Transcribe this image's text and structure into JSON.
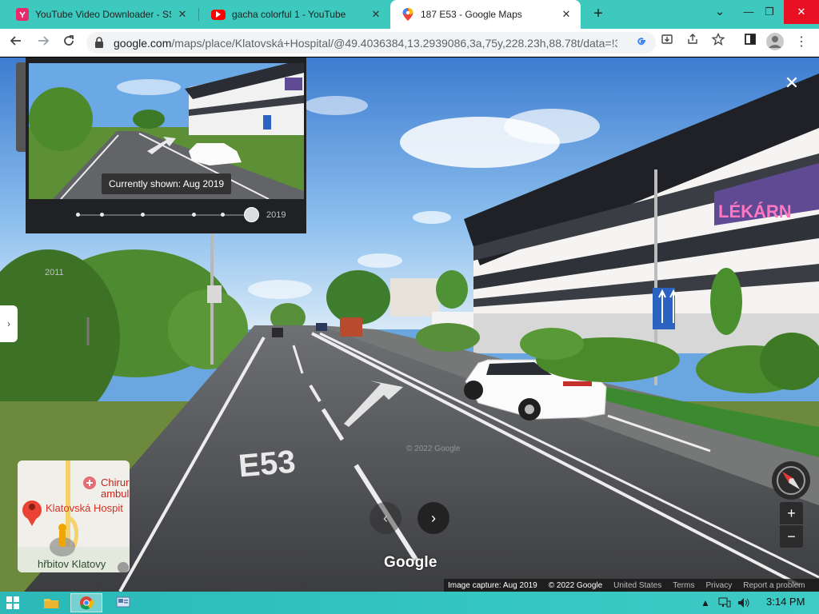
{
  "tabs": [
    {
      "title": "YouTube Video Downloader - SS",
      "favicon": "ssyoutube-icon",
      "active": false
    },
    {
      "title": "gacha colorful 1 - YouTube",
      "favicon": "youtube-icon",
      "active": false
    },
    {
      "title": "187 E53 - Google Maps",
      "favicon": "google-maps-icon",
      "active": true
    }
  ],
  "window_controls": {
    "new_tab": "+",
    "tab_search": "⌄",
    "minimize": "—",
    "restore": "❐",
    "close": "✕"
  },
  "toolbar": {
    "url_host": "google.com",
    "url_path": "/maps/place/Klatovská+Hospital/@49.4036384,13.2939086,3a,75y,228.23h,88.78t/data=!3...",
    "icons": [
      "back-icon",
      "forward-icon",
      "reload-icon",
      "lock-icon",
      "google-lens-icon",
      "install-icon",
      "share-icon",
      "bookmark-star-icon",
      "side-panel-icon",
      "profile-icon",
      "menu-icon"
    ]
  },
  "timeline": {
    "tooltip": "Currently shown: Aug 2019",
    "start_year": "2011",
    "end_year": "2019",
    "selected_fraction": 1.0
  },
  "streetview": {
    "road_marking": "E53",
    "building_sign": "LÉKÁRN",
    "watermark": "© 2022 Google",
    "logo": "Google"
  },
  "minimap": {
    "labels": [
      "Chirur",
      "ambul",
      "Klatovská Hospit",
      "hřbitov Klatovy"
    ]
  },
  "attribution": {
    "capture": "Image capture: Aug 2019",
    "copyright": "© 2022 Google",
    "country": "United States",
    "terms": "Terms",
    "privacy": "Privacy",
    "report": "Report a problem"
  },
  "controls": {
    "zoom_in": "+",
    "zoom_out": "−",
    "close": "✕",
    "next": "›",
    "prev": "‹",
    "side": "›"
  },
  "taskbar": {
    "time": "3:14 PM",
    "apps": [
      "file-explorer-icon",
      "chrome-icon",
      "control-panel-icon"
    ]
  }
}
